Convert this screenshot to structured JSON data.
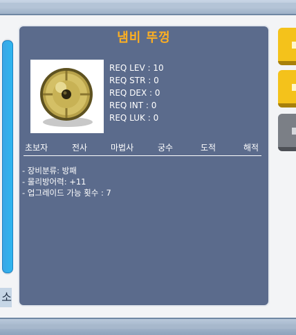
{
  "item": {
    "name": "냄비 뚜껑",
    "icon": "pot-lid-shield-icon"
  },
  "requirements": [
    "REQ LEV : 10",
    "REQ STR : 0",
    "REQ DEX : 0",
    "REQ INT : 0",
    "REQ LUK : 0"
  ],
  "jobs": [
    "초보자",
    "전사",
    "마법사",
    "궁수",
    "도적",
    "해적"
  ],
  "description": [
    "- 장비분류: 방패",
    "- 물리방어력: +11",
    "- 업그레이드 가능 횟수 : 7"
  ],
  "side_label": "소",
  "colors": {
    "title": "#ffb020",
    "panel": "#5b6b8c",
    "button_yellow": "#f4c21b",
    "button_gray": "#7b7f86",
    "scrollbar": "#2fb6ef"
  }
}
